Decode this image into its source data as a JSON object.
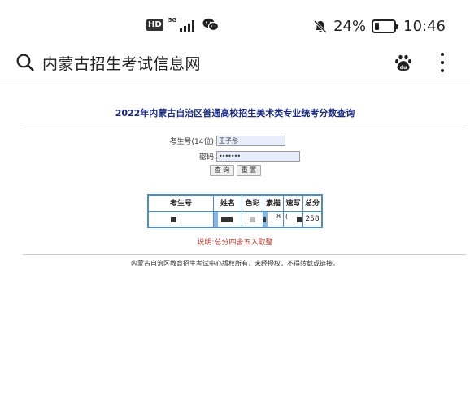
{
  "status_bar": {
    "hd": "HD",
    "network": "5G",
    "battery_percent": "24%",
    "battery_level": 0.24,
    "time": "10:46"
  },
  "browser": {
    "search_text": "内蒙古招生考试信息网"
  },
  "page": {
    "title": "2022年内蒙古自治区普通高校招生美术类专业统考分数查询",
    "form": {
      "id_label": "考生号(14位):",
      "id_value": "王子彤",
      "password_label": "密码:",
      "password_value": "•••••••",
      "query_button": "查 询",
      "reset_button": "重 置"
    },
    "table": {
      "headers": [
        "考生号",
        "姓名",
        "色彩",
        "素描",
        "速写",
        "总分"
      ],
      "row": {
        "sumiao_partial": "8",
        "suxie_partial": "(",
        "total": "258"
      }
    },
    "note": "说明:总分四舍五入取整",
    "footer": "内蒙古自治区教育招生考试中心版权所有，未经授权，不得转载或链接。"
  },
  "colors": {
    "title": "#1a2a80",
    "table_border": "#4a90c8",
    "note": "#c0392b",
    "input_bg": "#e8edfb"
  },
  "icons": [
    "wechat-icon",
    "mute-bell-icon",
    "battery-icon",
    "search-icon",
    "baidu-paw-icon",
    "more-icon"
  ]
}
